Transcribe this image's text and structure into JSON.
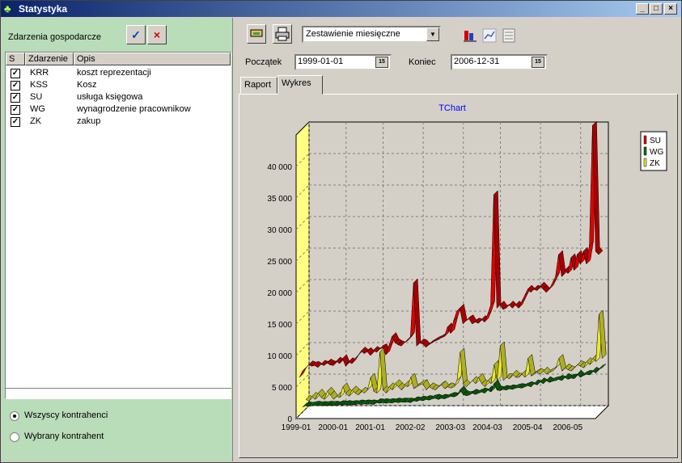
{
  "window": {
    "title": "Statystyka",
    "app_icon": "chart-icon",
    "controls": [
      "_",
      "□",
      "×"
    ]
  },
  "left": {
    "header": "Zdarzenia gospodarcze",
    "buttons": {
      "accept": "✓",
      "reject": "×"
    },
    "columns": [
      "S",
      "Zdarzenie",
      "Opis"
    ],
    "rows": [
      {
        "code": "KRR",
        "desc": "koszt reprezentacji",
        "checked": true
      },
      {
        "code": "KSS",
        "desc": "Kosz",
        "checked": true
      },
      {
        "code": "SU",
        "desc": "usługa księgowa",
        "checked": true
      },
      {
        "code": "WG",
        "desc": "wynagrodzenie pracownikow",
        "checked": true
      },
      {
        "code": "ZK",
        "desc": "zakup",
        "checked": true
      }
    ],
    "radios": [
      {
        "label": "Wszyscy kontrahenci",
        "selected": true
      },
      {
        "label": "Wybrany kontrahent",
        "selected": false
      }
    ]
  },
  "toolbar": {
    "report_type": "Zestawienie miesięczne",
    "start_label": "Początek",
    "start_value": "1999-01-01",
    "end_label": "Koniec",
    "end_value": "2006-12-31",
    "calendar_glyph": "15"
  },
  "tabs": [
    {
      "label": "Raport",
      "active": false
    },
    {
      "label": "Wykres",
      "active": true
    }
  ],
  "chart_data": {
    "type": "line",
    "title": "TChart",
    "xlabel": "",
    "ylabel": "",
    "ylim": [
      0,
      45000
    ],
    "yticks": [
      0,
      5000,
      10000,
      15000,
      20000,
      25000,
      30000,
      35000,
      40000
    ],
    "ytick_labels": [
      "0",
      "5 000",
      "10 000",
      "15 000",
      "20 000",
      "25 000",
      "30 000",
      "35 000",
      "40 000"
    ],
    "xtick_labels": [
      "1999-01",
      "2000-01",
      "2001-01",
      "2002-02",
      "2003-03",
      "2004-03",
      "2005-04",
      "2006-05"
    ],
    "xtick_index": [
      0,
      12,
      24,
      37,
      50,
      62,
      75,
      88
    ],
    "legend": {
      "placement": "right",
      "entries": [
        "SU",
        "WG",
        "ZK"
      ]
    },
    "grid": true,
    "series": [
      {
        "name": "SU",
        "color": "#e00000",
        "values": [
          6000,
          7000,
          7500,
          8000,
          7800,
          7900,
          7600,
          8100,
          7900,
          8300,
          8000,
          7900,
          8600,
          8200,
          9000,
          7800,
          8500,
          8200,
          9000,
          9500,
          10200,
          9800,
          10100,
          9500,
          10300,
          10000,
          10500,
          10700,
          9600,
          11000,
          12500,
          11500,
          11200,
          11000,
          11500,
          11800,
          12500,
          21000,
          11000,
          11500,
          11300,
          10800,
          11200,
          11500,
          11800,
          12000,
          12300,
          12500,
          14000,
          13000,
          15000,
          16500,
          17000,
          14500,
          15000,
          15300,
          14500,
          14800,
          14600,
          15200,
          14800,
          16000,
          17500,
          35000,
          17000,
          17500,
          16800,
          17000,
          17500,
          17000,
          17500,
          17000,
          18000,
          19000,
          20000,
          19500,
          20000,
          19800,
          20500,
          20000,
          19500,
          20000,
          21000,
          22000,
          25500,
          22000,
          23000,
          22500,
          25000,
          23000,
          25500,
          24000,
          26000,
          24000,
          27000,
          46000,
          26000,
          25500
        ]
      },
      {
        "name": "WG",
        "color": "#107010",
        "values": [
          800,
          1000,
          900,
          1000,
          1100,
          1000,
          1050,
          1000,
          1100,
          1050,
          1100,
          1000,
          1200,
          1100,
          1200,
          1100,
          1200,
          1150,
          1300,
          1200,
          1300,
          1250,
          1300,
          1200,
          1500,
          1400,
          1500,
          1400,
          1500,
          1450,
          1600,
          1500,
          1600,
          1550,
          1600,
          1500,
          1800,
          1700,
          1900,
          1800,
          2000,
          1900,
          2100,
          2200,
          2000,
          2200,
          2100,
          2300,
          2500,
          2400,
          2600,
          3500,
          2800,
          2600,
          2700,
          3000,
          2800,
          3000,
          3200,
          3000,
          3500,
          3200,
          4500,
          3500,
          3400,
          3600,
          3500,
          3700,
          3600,
          3800,
          3900,
          3800,
          4000,
          4200,
          4000,
          4500,
          4300,
          4800,
          4500,
          5000,
          4700,
          4900,
          5000,
          5200,
          5000,
          5500,
          5200,
          5400,
          5300,
          6000,
          5500,
          5800,
          6000,
          5900,
          6500,
          6200,
          6800,
          7000
        ]
      },
      {
        "name": "ZK",
        "color": "#e8e830",
        "values": [
          1500,
          1200,
          2000,
          1500,
          2500,
          1800,
          1500,
          2800,
          2200,
          1500,
          2000,
          1800,
          3500,
          2500,
          2000,
          3000,
          2500,
          2200,
          2800,
          2500,
          3000,
          5000,
          2800,
          2500,
          9000,
          3000,
          2500,
          3500,
          3000,
          4000,
          3500,
          3000,
          3800,
          3500,
          5000,
          3200,
          3500,
          3800,
          4000,
          3000,
          3500,
          3200,
          3000,
          3500,
          3800,
          3200,
          3500,
          3300,
          3500,
          4500,
          9000,
          4000,
          3500,
          4000,
          4500,
          4000,
          5000,
          4000,
          3500,
          4500,
          4000,
          7000,
          4500,
          10000,
          4500,
          5000,
          4800,
          5500,
          5000,
          5000,
          5500,
          5000,
          8000,
          5200,
          5500,
          5800,
          5500,
          6000,
          5500,
          5800,
          6000,
          6500,
          8000,
          6000,
          6500,
          6200,
          6000,
          6500,
          7000,
          6800,
          6500,
          7500,
          7000,
          8000,
          7500,
          15000,
          8000
        ]
      }
    ]
  }
}
